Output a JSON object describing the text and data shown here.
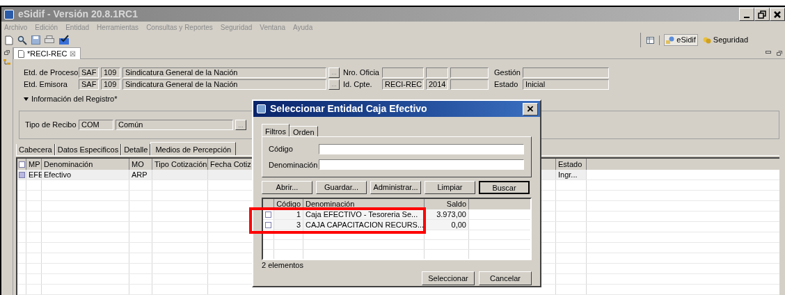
{
  "window": {
    "title": "eSidif - Versión 20.8.1RC1"
  },
  "menu": [
    "Archivo",
    "Edición",
    "Entidad",
    "Herramientas",
    "Consultas y Reportes",
    "Seguridad",
    "Ventana",
    "Ayuda"
  ],
  "perspectives": [
    {
      "label": "eSidif",
      "selected": true
    },
    {
      "label": "Seguridad",
      "selected": false
    }
  ],
  "editor_tab": {
    "label": "*RECI-REC",
    "close": "☒"
  },
  "form": {
    "rows": [
      {
        "label": "Etd. de Proceso",
        "type": "SAF",
        "code": "109",
        "name": "Sindicatura General de la Nación",
        "button": "...",
        "ref_label": "Nro. Oficia",
        "right_label": "Gestión"
      },
      {
        "label": "Etd. Emisora",
        "type": "SAF",
        "code": "109",
        "name": "Sindicatura General de la Nación",
        "button": "...",
        "ref_label": "Id. Cpte.",
        "ref_values": [
          "RECI-REC",
          "2014"
        ],
        "right_label": "Estado",
        "right_value": "Inicial"
      }
    ]
  },
  "section": {
    "title": "Información del Registro*",
    "expanded": true,
    "receipt_label": "Tipo de Recibo",
    "receipt_code": "COM",
    "receipt_name": "Común",
    "button": "..."
  },
  "tabs": [
    {
      "label": "Cabecera",
      "selected": false
    },
    {
      "label": "Datos Especificos",
      "selected": false
    },
    {
      "label": "Detalle",
      "selected": false
    },
    {
      "label": "Medios de Percepción",
      "selected": true
    }
  ],
  "table": {
    "columns": [
      "MP",
      "Denominación",
      "MO",
      "Tipo Cotización",
      "Fecha Cotiz",
      "Estado"
    ],
    "all_checked": false,
    "rows": [
      {
        "checked": true,
        "selected": true,
        "cells": [
          "EFE",
          "Efectivo",
          "ARP",
          "",
          "",
          "Ingr..."
        ]
      }
    ]
  },
  "dialog": {
    "title": "Seleccionar Entidad Caja Efectivo",
    "close": "×",
    "tabs": [
      {
        "label": "Filtros",
        "selected": true
      },
      {
        "label": "Orden",
        "selected": false
      }
    ],
    "fields": [
      {
        "label": "Código"
      },
      {
        "label": "Denominación"
      }
    ],
    "actions": [
      {
        "label": "Abrir...",
        "default": false
      },
      {
        "label": "Guardar...",
        "default": false
      },
      {
        "label": "Administrar...",
        "default": false
      },
      {
        "label": "Limpiar",
        "default": false
      },
      {
        "label": "Buscar",
        "default": true
      }
    ],
    "table": {
      "columns": [
        "Código",
        "Denominación",
        "Saldo"
      ],
      "rows": [
        {
          "checked": false,
          "cells": [
            "1",
            "Caja EFECTIVO - Tesoreria Se...",
            "3.973,00"
          ]
        },
        {
          "checked": false,
          "cells": [
            "3",
            "CAJA CAPACITACION RECURS...",
            "0,00"
          ]
        }
      ]
    },
    "status": "2 elementos",
    "buttons": [
      "Seleccionar",
      "Cancelar"
    ]
  }
}
